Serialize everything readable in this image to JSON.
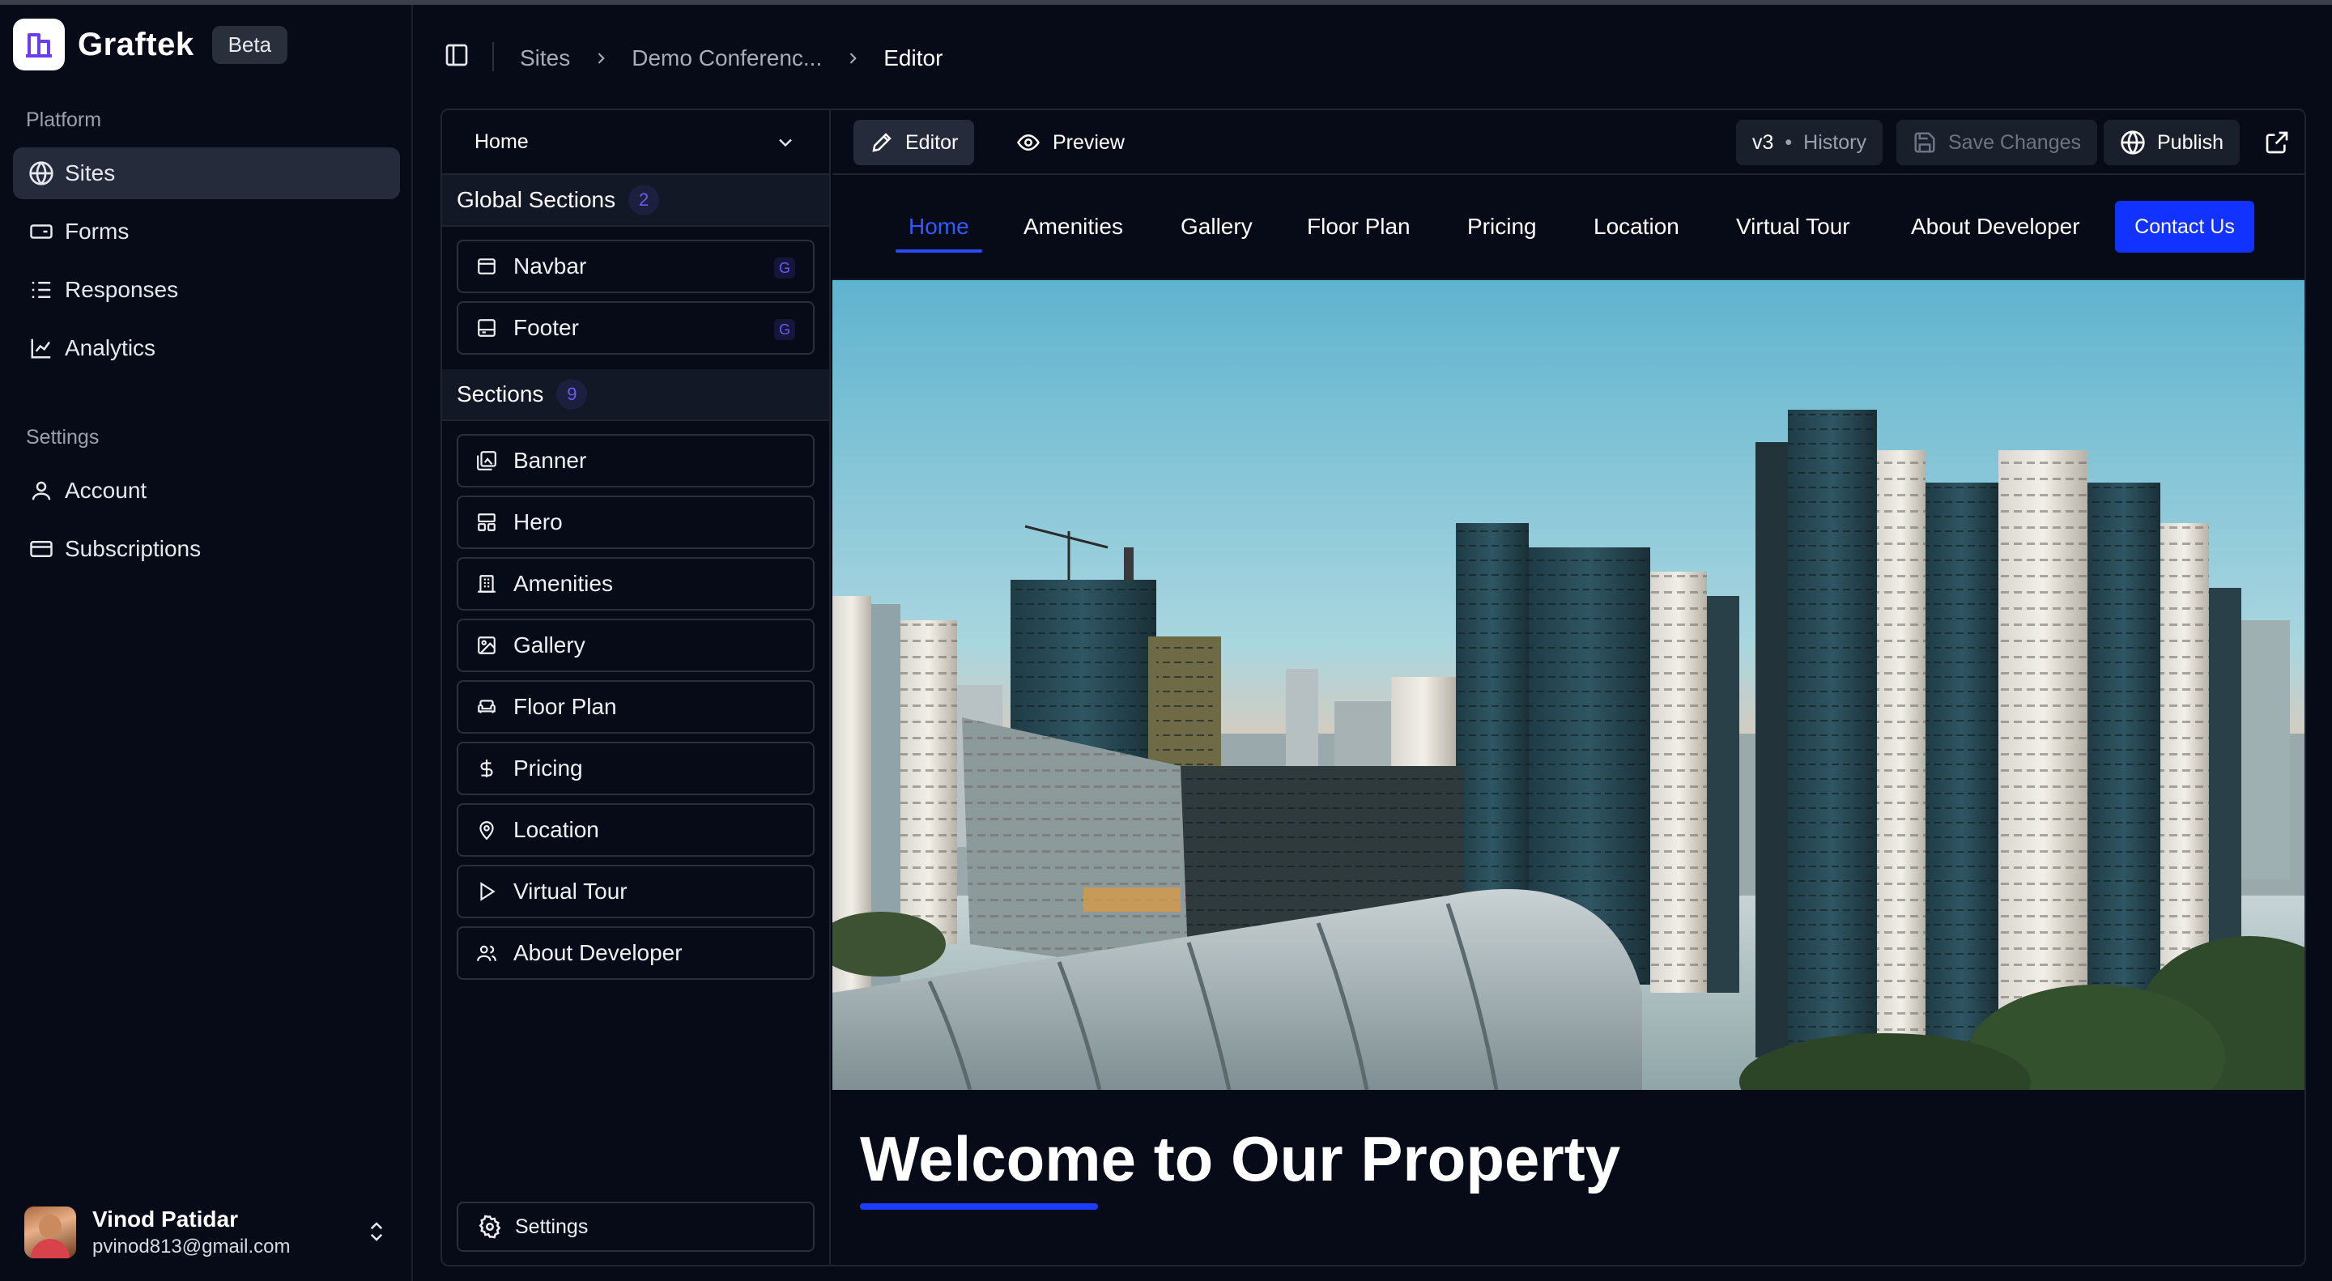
{
  "app": {
    "brand_name": "Graftek",
    "badge": "Beta"
  },
  "sidebar": {
    "platform_label": "Platform",
    "settings_label": "Settings",
    "platform_items": [
      {
        "label": "Sites",
        "icon": "globe-icon",
        "active": true
      },
      {
        "label": "Forms",
        "icon": "form-icon",
        "active": false
      },
      {
        "label": "Responses",
        "icon": "list-icon",
        "active": false
      },
      {
        "label": "Analytics",
        "icon": "chart-line-icon",
        "active": false
      }
    ],
    "settings_items": [
      {
        "label": "Account",
        "icon": "user-icon"
      },
      {
        "label": "Subscriptions",
        "icon": "card-icon"
      }
    ],
    "user": {
      "name": "Vinod Patidar",
      "email": "pvinod813@gmail.com"
    }
  },
  "breadcrumb": [
    "Sites",
    "Demo Conferenc...",
    "Editor"
  ],
  "panel": {
    "page_select": "Home",
    "global_heading": "Global Sections",
    "global_count": "2",
    "global_items": [
      {
        "label": "Navbar",
        "icon": "window-icon",
        "badge": "G"
      },
      {
        "label": "Footer",
        "icon": "footer-icon",
        "badge": "G"
      }
    ],
    "sections_heading": "Sections",
    "sections_count": "9",
    "section_items": [
      {
        "label": "Banner",
        "icon": "images-icon"
      },
      {
        "label": "Hero",
        "icon": "layout-icon"
      },
      {
        "label": "Amenities",
        "icon": "building-icon"
      },
      {
        "label": "Gallery",
        "icon": "image-icon"
      },
      {
        "label": "Floor Plan",
        "icon": "sofa-icon"
      },
      {
        "label": "Pricing",
        "icon": "dollar-icon"
      },
      {
        "label": "Location",
        "icon": "map-pin-icon"
      },
      {
        "label": "Virtual Tour",
        "icon": "play-icon"
      },
      {
        "label": "About Developer",
        "icon": "users-icon"
      }
    ],
    "settings_label": "Settings"
  },
  "toolbar": {
    "editor_label": "Editor",
    "preview_label": "Preview",
    "version": "v3",
    "history_label": "History",
    "save_label": "Save Changes",
    "publish_label": "Publish"
  },
  "site": {
    "nav_links": [
      "Home",
      "Amenities",
      "Gallery",
      "Floor Plan",
      "Pricing",
      "Location",
      "Virtual Tour",
      "About Developer"
    ],
    "active_link": "Home",
    "cta_label": "Contact Us",
    "welcome_title": "Welcome to Our Property",
    "accent_color": "#1132ff"
  }
}
